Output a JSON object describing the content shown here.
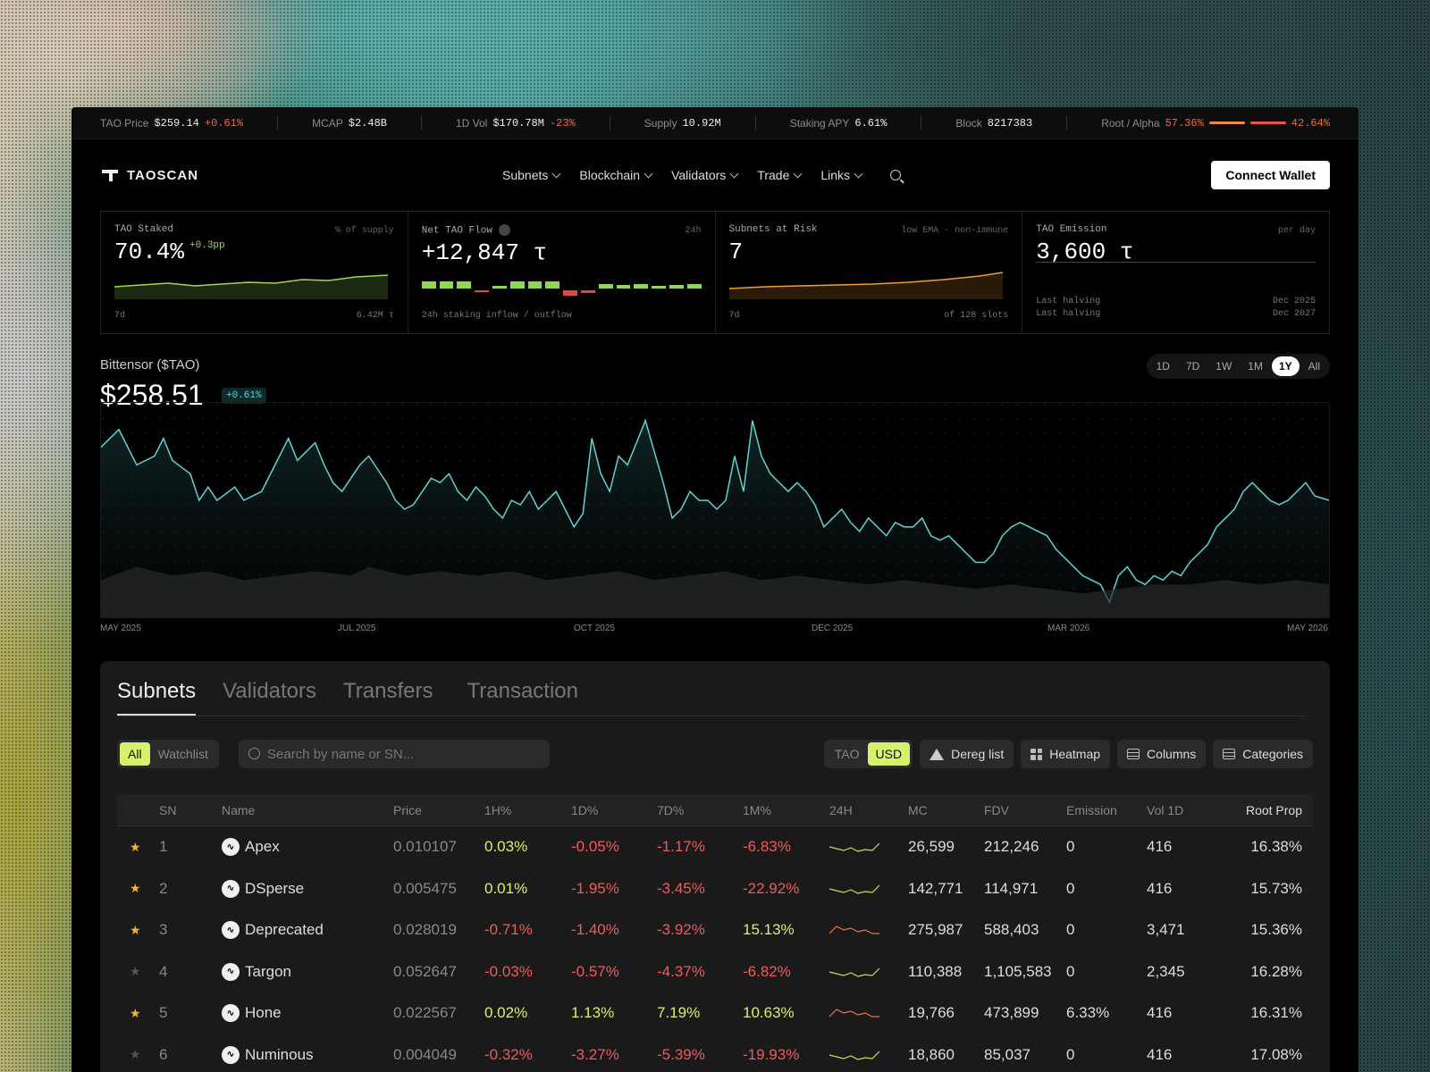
{
  "ticker": [
    {
      "label": "TAO Price",
      "value": "$259.14",
      "delta": "+0.61%"
    },
    {
      "label": "MCAP",
      "value": "$2.48B"
    },
    {
      "label": "1D Vol",
      "value": "$170.78M",
      "delta": "-23%"
    },
    {
      "label": "Supply",
      "value": "10.92M"
    },
    {
      "label": "Staking APY",
      "value": "6.61%"
    },
    {
      "label": "Block",
      "value": "8217383"
    },
    {
      "label": "Root / Alpha",
      "left": "57.36%",
      "right": "42.64%"
    }
  ],
  "nav": {
    "brand": "TAOSCAN",
    "menu": [
      "Subnets",
      "Blockchain",
      "Validators",
      "Trade",
      "Links"
    ],
    "connect": "Connect Wallet"
  },
  "stats": {
    "staked": {
      "title": "TAO Staked",
      "sub": "% of supply",
      "value": "70.4%",
      "delta": "+0.3pp",
      "foot_l": "7d",
      "foot_r": "6.42M τ"
    },
    "flow": {
      "title": "Net TAO Flow",
      "sub": "24h",
      "value": "+12,847 τ",
      "foot": "24h staking inflow / outflow"
    },
    "risk": {
      "title": "Subnets at Risk",
      "sub": "low EMA · non-immune",
      "value": "7",
      "foot_l": "7d",
      "foot_r": "of 128 slots"
    },
    "emission": {
      "title": "TAO Emission",
      "sub": "per day",
      "value": "3,600 τ",
      "rows": [
        {
          "label": "Last halving",
          "date": "Dec 2025"
        },
        {
          "label": "Last halving",
          "date": "Dec 2027"
        }
      ]
    }
  },
  "price_chart": {
    "name": "Bittensor ($TAO)",
    "price": "$258.51",
    "delta": "+0.61%",
    "ranges": [
      "1D",
      "7D",
      "1W",
      "1M",
      "1Y",
      "All"
    ],
    "active_range": "1Y",
    "x_labels": [
      "MAY 2025",
      "JUL 2025",
      "OCT 2025",
      "DEC 2025",
      "MAR 2026",
      "MAY 2026"
    ]
  },
  "tabs": [
    "Subnets",
    "Validators",
    "Transfers",
    "Transaction"
  ],
  "filters": {
    "all": "All",
    "watchlist": "Watchlist",
    "search_placeholder": "Search by name or SN...",
    "tao": "TAO",
    "usd": "USD",
    "dereg": "Dereg list",
    "heatmap": "Heatmap",
    "columns": "Columns",
    "categories": "Categories"
  },
  "table": {
    "headers": [
      "SN",
      "Name",
      "Price",
      "1H%",
      "1D%",
      "7D%",
      "1M%",
      "24H",
      "MC",
      "FDV",
      "Emission",
      "Vol 1D",
      "Root Prop"
    ],
    "rows": [
      {
        "starred": true,
        "sn": "1",
        "name": "Apex",
        "price": "0.010107",
        "h1": "0.03%",
        "d1": "-0.05%",
        "d7": "-1.17%",
        "m1": "-6.83%",
        "mc": "26,599",
        "fdv": "212,246",
        "em": "0",
        "vol": "416",
        "rp": "16.38%",
        "spark": "g"
      },
      {
        "starred": true,
        "sn": "2",
        "name": "DSperse",
        "price": "0.005475",
        "h1": "0.01%",
        "d1": "-1.95%",
        "d7": "-3.45%",
        "m1": "-22.92%",
        "mc": "142,771",
        "fdv": "114,971",
        "em": "0",
        "vol": "416",
        "rp": "15.73%",
        "spark": "g"
      },
      {
        "starred": true,
        "sn": "3",
        "name": "Deprecated",
        "price": "0.028019",
        "h1": "-0.71%",
        "d1": "-1.40%",
        "d7": "-3.92%",
        "m1": "15.13%",
        "mc": "275,987",
        "fdv": "588,403",
        "em": "0",
        "vol": "3,471",
        "rp": "15.36%",
        "spark": "r"
      },
      {
        "starred": false,
        "sn": "4",
        "name": "Targon",
        "price": "0.052647",
        "h1": "-0.03%",
        "d1": "-0.57%",
        "d7": "-4.37%",
        "m1": "-6.82%",
        "mc": "110,388",
        "fdv": "1,105,583",
        "em": "0",
        "vol": "2,345",
        "rp": "16.28%",
        "spark": "g"
      },
      {
        "starred": true,
        "sn": "5",
        "name": "Hone",
        "price": "0.022567",
        "h1": "0.02%",
        "d1": "1.13%",
        "d7": "7.19%",
        "m1": "10.63%",
        "mc": "19,766",
        "fdv": "473,899",
        "em": "6.33%",
        "vol": "416",
        "rp": "16.31%",
        "spark": "r"
      },
      {
        "starred": false,
        "sn": "6",
        "name": "Numinous",
        "price": "0.004049",
        "h1": "-0.32%",
        "d1": "-3.27%",
        "d7": "-5.39%",
        "m1": "-19.93%",
        "mc": "18,860",
        "fdv": "85,037",
        "em": "0",
        "vol": "416",
        "rp": "17.08%",
        "spark": "g"
      }
    ]
  },
  "colors": {
    "accent": "#d6f26b",
    "negative": "#f05a5a",
    "teal": "#5fd4d4",
    "orange": "#f59a3a"
  }
}
